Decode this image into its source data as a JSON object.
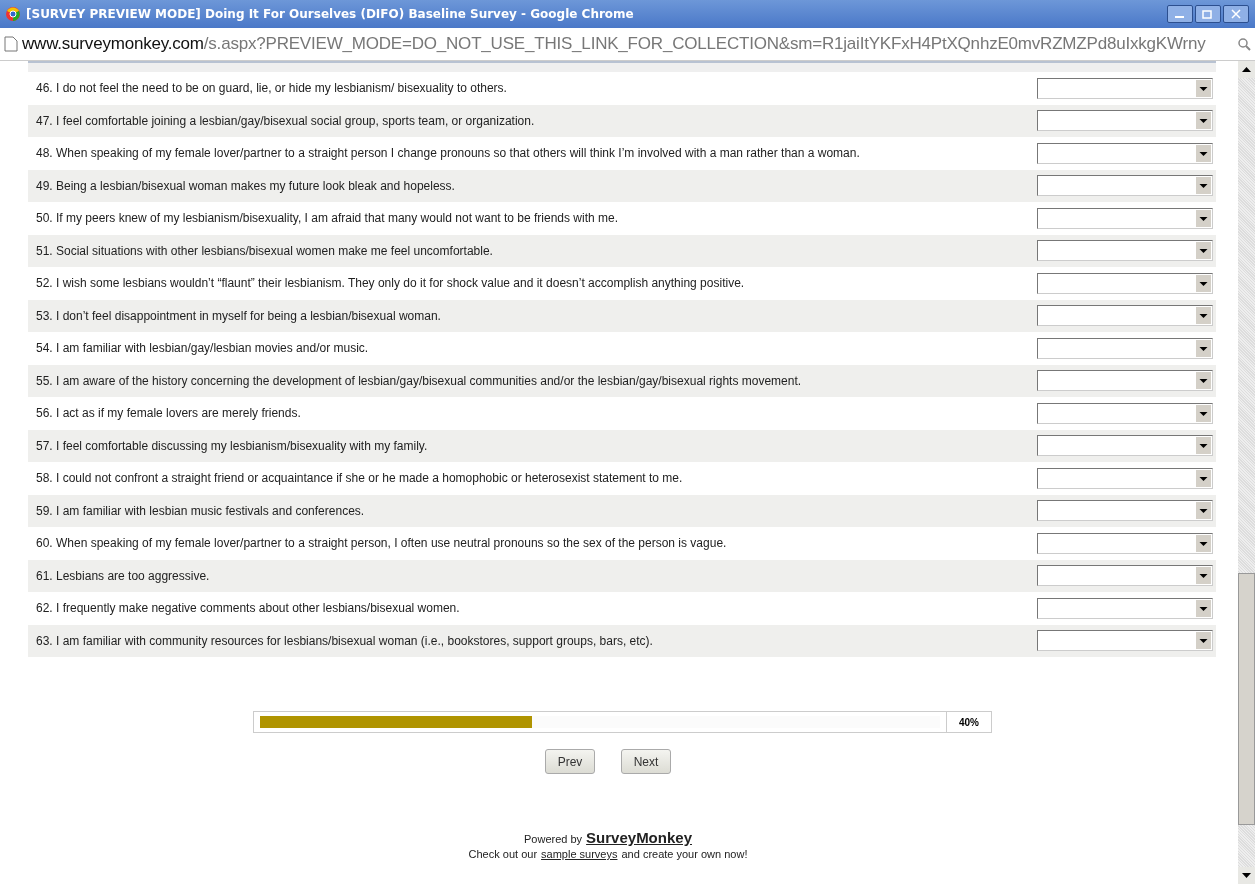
{
  "window": {
    "title": "[SURVEY PREVIEW MODE] Doing It For Ourselves (DIFO) Baseline Survey - Google Chrome"
  },
  "address_bar": {
    "domain": "www.surveymonkey.com",
    "path": "/s.aspx?PREVIEW_MODE=DO_NOT_USE_THIS_LINK_FOR_COLLECTION&sm=R1jaiItYKFxH4PtXQnhzE0mvRZMZPd8uIxkgKWrny"
  },
  "questions": [
    {
      "text": "46. I do not feel the need to be on guard, lie, or hide my lesbianism/ bisexuality to others."
    },
    {
      "text": "47. I feel comfortable joining a lesbian/gay/bisexual social group, sports team, or organization."
    },
    {
      "text": "48. When speaking of my female lover/partner to a straight person I change pronouns so that others will think I’m involved with a man rather than a woman."
    },
    {
      "text": "49. Being a lesbian/bisexual woman makes my future look bleak and hopeless."
    },
    {
      "text": "50. If my peers knew of my lesbianism/bisexuality, I am afraid that many would not want to be friends with me."
    },
    {
      "text": "51. Social situations with other lesbians/bisexual women make me feel uncomfortable."
    },
    {
      "text": "52. I wish some lesbians wouldn’t “flaunt” their lesbianism. They only do it for shock value and it doesn’t accomplish anything positive."
    },
    {
      "text": "53. I don’t feel disappointment in myself for being a lesbian/bisexual woman."
    },
    {
      "text": "54. I am familiar with lesbian/gay/lesbian movies and/or music."
    },
    {
      "text": "55. I am aware of the history concerning the development of lesbian/gay/bisexual communities and/or the lesbian/gay/bisexual rights movement."
    },
    {
      "text": "56. I act as if my female lovers are merely friends."
    },
    {
      "text": "57. I feel comfortable discussing my lesbianism/bisexuality with my family."
    },
    {
      "text": "58. I could not confront a straight friend or acquaintance if she or he made a homophobic or heterosexist statement to me."
    },
    {
      "text": "59. I am familiar with lesbian music festivals and conferences."
    },
    {
      "text": "60. When speaking of my female lover/partner to a straight person, I often use neutral pronouns so the sex of the person is vague."
    },
    {
      "text": "61. Lesbians are too aggressive."
    },
    {
      "text": "62. I frequently make negative comments about other lesbians/bisexual women."
    },
    {
      "text": "63. I am familiar with community resources for lesbians/bisexual woman (i.e., bookstores, support groups, bars, etc)."
    }
  ],
  "progress": {
    "level": 0.4,
    "label": "40%"
  },
  "buttons": [
    "Prev",
    "Next"
  ],
  "footer": {
    "powered_by": "Powered by",
    "brand": "SurveyMonkey",
    "line_before": "Check out our",
    "link": "sample surveys",
    "line_after": "and create your own now!"
  }
}
